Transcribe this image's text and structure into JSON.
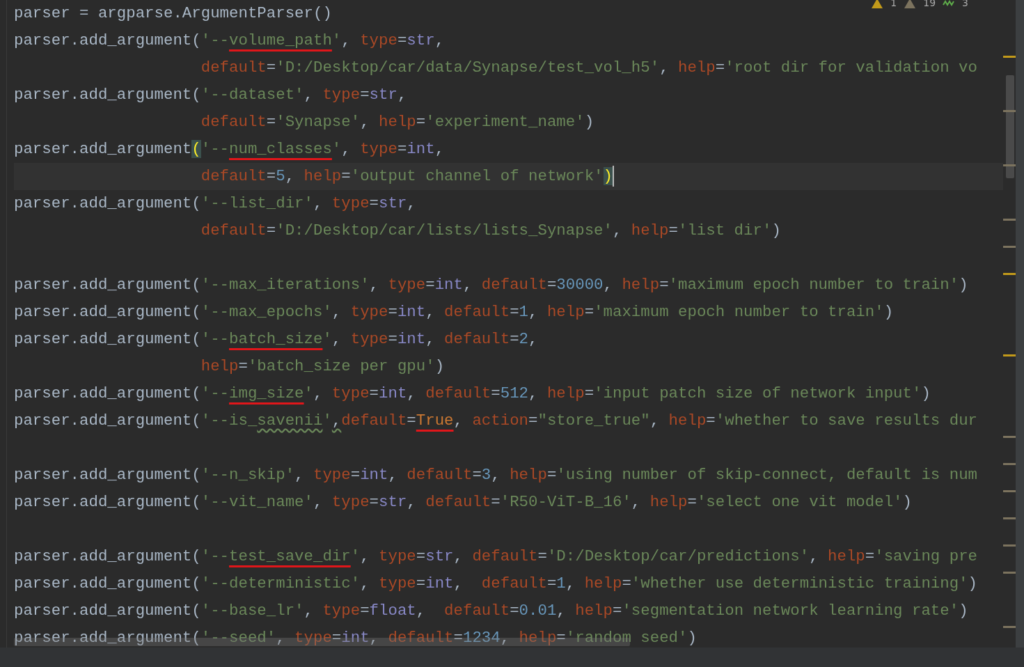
{
  "inspections": [
    {
      "kind": "warning",
      "count": "1"
    },
    {
      "kind": "weak",
      "count": "19"
    },
    {
      "kind": "typo",
      "count": "3"
    }
  ],
  "lines": [
    {
      "tokens": [
        {
          "kind": "plain",
          "text": "parser = argparse.ArgumentParser()"
        }
      ]
    },
    {
      "marker_warning": true,
      "tokens": [
        {
          "kind": "plain",
          "text": "parser.add_argument("
        },
        {
          "kind": "string",
          "text": "'--"
        },
        {
          "kind": "string",
          "text": "volume_path",
          "marked": true
        },
        {
          "kind": "string",
          "text": "'"
        },
        {
          "kind": "plain",
          "text": ", "
        },
        {
          "kind": "arg",
          "text": "type"
        },
        {
          "kind": "plain",
          "text": "="
        },
        {
          "kind": "builtin",
          "text": "str"
        },
        {
          "kind": "plain",
          "text": ","
        }
      ]
    },
    {
      "indent": true,
      "tokens": [
        {
          "kind": "arg",
          "text": "default"
        },
        {
          "kind": "plain",
          "text": "="
        },
        {
          "kind": "string",
          "text": "'D:/Desktop/car/data/Synapse/test_vol_h5'"
        },
        {
          "kind": "plain",
          "text": ", "
        },
        {
          "kind": "arg",
          "text": "help"
        },
        {
          "kind": "plain",
          "text": "="
        },
        {
          "kind": "string",
          "text": "'root dir for validation vo"
        }
      ]
    },
    {
      "marker_weak": true,
      "tokens": [
        {
          "kind": "plain",
          "text": "parser.add_argument("
        },
        {
          "kind": "string",
          "text": "'--dataset'"
        },
        {
          "kind": "plain",
          "text": ", "
        },
        {
          "kind": "arg",
          "text": "type"
        },
        {
          "kind": "plain",
          "text": "="
        },
        {
          "kind": "builtin",
          "text": "str"
        },
        {
          "kind": "plain",
          "text": ","
        }
      ]
    },
    {
      "indent": true,
      "tokens": [
        {
          "kind": "arg",
          "text": "default"
        },
        {
          "kind": "plain",
          "text": "="
        },
        {
          "kind": "string",
          "text": "'Synapse'"
        },
        {
          "kind": "plain",
          "text": ", "
        },
        {
          "kind": "arg",
          "text": "help"
        },
        {
          "kind": "plain",
          "text": "="
        },
        {
          "kind": "string",
          "text": "'experiment_name'"
        },
        {
          "kind": "plain",
          "text": ")"
        }
      ]
    },
    {
      "marker_weak": true,
      "tokens": [
        {
          "kind": "plain",
          "text": "parser.add_argument"
        },
        {
          "kind": "plain",
          "text": "(",
          "match": true
        },
        {
          "kind": "string",
          "text": "'--"
        },
        {
          "kind": "string",
          "text": "num_classes",
          "marked": true
        },
        {
          "kind": "string",
          "text": "'"
        },
        {
          "kind": "plain",
          "text": ", "
        },
        {
          "kind": "arg",
          "text": "type"
        },
        {
          "kind": "plain",
          "text": "="
        },
        {
          "kind": "builtin",
          "text": "int"
        },
        {
          "kind": "plain",
          "text": ","
        }
      ]
    },
    {
      "indent": true,
      "current": true,
      "tokens": [
        {
          "kind": "arg",
          "text": "default"
        },
        {
          "kind": "plain",
          "text": "="
        },
        {
          "kind": "number",
          "text": "5"
        },
        {
          "kind": "plain",
          "text": ", "
        },
        {
          "kind": "arg",
          "text": "help"
        },
        {
          "kind": "plain",
          "text": "="
        },
        {
          "kind": "string",
          "text": "'output channel of network'"
        },
        {
          "kind": "plain",
          "text": ")",
          "match": true
        }
      ]
    },
    {
      "marker_weak": true,
      "tokens": [
        {
          "kind": "plain",
          "text": "parser.add_argument("
        },
        {
          "kind": "string",
          "text": "'--list_dir'"
        },
        {
          "kind": "plain",
          "text": ", "
        },
        {
          "kind": "arg",
          "text": "type"
        },
        {
          "kind": "plain",
          "text": "="
        },
        {
          "kind": "builtin",
          "text": "str"
        },
        {
          "kind": "plain",
          "text": ","
        }
      ]
    },
    {
      "indent": true,
      "marker_weak": true,
      "tokens": [
        {
          "kind": "arg",
          "text": "default"
        },
        {
          "kind": "plain",
          "text": "="
        },
        {
          "kind": "string",
          "text": "'D:/Desktop/car/lists/lists_Synapse'"
        },
        {
          "kind": "plain",
          "text": ", "
        },
        {
          "kind": "arg",
          "text": "help"
        },
        {
          "kind": "plain",
          "text": "="
        },
        {
          "kind": "string",
          "text": "'list dir'"
        },
        {
          "kind": "plain",
          "text": ")"
        }
      ]
    },
    {
      "marker_warning": true
    },
    {
      "tokens": [
        {
          "kind": "plain",
          "text": "parser.add_argument("
        },
        {
          "kind": "string",
          "text": "'--max_iterations'"
        },
        {
          "kind": "plain",
          "text": ", "
        },
        {
          "kind": "arg",
          "text": "type"
        },
        {
          "kind": "plain",
          "text": "="
        },
        {
          "kind": "builtin",
          "text": "int"
        },
        {
          "kind": "plain",
          "text": ", "
        },
        {
          "kind": "arg",
          "text": "default"
        },
        {
          "kind": "plain",
          "text": "="
        },
        {
          "kind": "number",
          "text": "30000"
        },
        {
          "kind": "plain",
          "text": ", "
        },
        {
          "kind": "arg",
          "text": "help"
        },
        {
          "kind": "plain",
          "text": "="
        },
        {
          "kind": "string",
          "text": "'maximum epoch number to train'"
        },
        {
          "kind": "plain",
          "text": ")"
        }
      ]
    },
    {
      "tokens": [
        {
          "kind": "plain",
          "text": "parser.add_argument("
        },
        {
          "kind": "string",
          "text": "'--max_epochs'"
        },
        {
          "kind": "plain",
          "text": ", "
        },
        {
          "kind": "arg",
          "text": "type"
        },
        {
          "kind": "plain",
          "text": "="
        },
        {
          "kind": "builtin",
          "text": "int"
        },
        {
          "kind": "plain",
          "text": ", "
        },
        {
          "kind": "arg",
          "text": "default"
        },
        {
          "kind": "plain",
          "text": "="
        },
        {
          "kind": "number",
          "text": "1"
        },
        {
          "kind": "plain",
          "text": ", "
        },
        {
          "kind": "arg",
          "text": "help"
        },
        {
          "kind": "plain",
          "text": "="
        },
        {
          "kind": "string",
          "text": "'maximum epoch number to train'"
        },
        {
          "kind": "plain",
          "text": ")"
        }
      ]
    },
    {
      "marker_warning": true,
      "tokens": [
        {
          "kind": "plain",
          "text": "parser.add_argument("
        },
        {
          "kind": "string",
          "text": "'--"
        },
        {
          "kind": "string",
          "text": "batch_size",
          "marked": true
        },
        {
          "kind": "string",
          "text": "'"
        },
        {
          "kind": "plain",
          "text": ", "
        },
        {
          "kind": "arg",
          "text": "type"
        },
        {
          "kind": "plain",
          "text": "="
        },
        {
          "kind": "builtin",
          "text": "int"
        },
        {
          "kind": "plain",
          "text": ", "
        },
        {
          "kind": "arg",
          "text": "default"
        },
        {
          "kind": "plain",
          "text": "="
        },
        {
          "kind": "number",
          "text": "2"
        },
        {
          "kind": "plain",
          "text": ","
        }
      ]
    },
    {
      "indent": true,
      "tokens": [
        {
          "kind": "arg",
          "text": "help"
        },
        {
          "kind": "plain",
          "text": "="
        },
        {
          "kind": "string",
          "text": "'batch_size per gpu'"
        },
        {
          "kind": "plain",
          "text": ")"
        }
      ]
    },
    {
      "tokens": [
        {
          "kind": "plain",
          "text": "parser.add_argument("
        },
        {
          "kind": "string",
          "text": "'--"
        },
        {
          "kind": "string",
          "text": "img_size",
          "marked": true
        },
        {
          "kind": "string",
          "text": "'"
        },
        {
          "kind": "plain",
          "text": ", "
        },
        {
          "kind": "arg",
          "text": "type"
        },
        {
          "kind": "plain",
          "text": "="
        },
        {
          "kind": "builtin",
          "text": "int"
        },
        {
          "kind": "plain",
          "text": ", "
        },
        {
          "kind": "arg",
          "text": "default"
        },
        {
          "kind": "plain",
          "text": "="
        },
        {
          "kind": "number",
          "text": "512"
        },
        {
          "kind": "plain",
          "text": ", "
        },
        {
          "kind": "arg",
          "text": "help"
        },
        {
          "kind": "plain",
          "text": "="
        },
        {
          "kind": "string",
          "text": "'input patch size of network input'"
        },
        {
          "kind": "plain",
          "text": ")"
        }
      ]
    },
    {
      "marker_weak": true,
      "tokens": [
        {
          "kind": "plain",
          "text": "parser.add_argument("
        },
        {
          "kind": "string",
          "text": "'--is_"
        },
        {
          "kind": "string",
          "text": "savenii",
          "typo": true
        },
        {
          "kind": "string",
          "text": "'"
        },
        {
          "kind": "plain",
          "text": ",",
          "typo": true
        },
        {
          "kind": "arg",
          "text": "default"
        },
        {
          "kind": "plain",
          "text": "="
        },
        {
          "kind": "keyword",
          "text": "True",
          "marked": true
        },
        {
          "kind": "plain",
          "text": ", "
        },
        {
          "kind": "arg",
          "text": "action"
        },
        {
          "kind": "plain",
          "text": "="
        },
        {
          "kind": "string",
          "text": "\"store_true\""
        },
        {
          "kind": "plain",
          "text": ", "
        },
        {
          "kind": "arg",
          "text": "help"
        },
        {
          "kind": "plain",
          "text": "="
        },
        {
          "kind": "string",
          "text": "'whether to save results dur"
        }
      ]
    },
    {
      "marker_weak": true
    },
    {
      "marker_weak": true,
      "tokens": [
        {
          "kind": "plain",
          "text": "parser.add_argument("
        },
        {
          "kind": "string",
          "text": "'--n_skip'"
        },
        {
          "kind": "plain",
          "text": ", "
        },
        {
          "kind": "arg",
          "text": "type"
        },
        {
          "kind": "plain",
          "text": "="
        },
        {
          "kind": "builtin",
          "text": "int"
        },
        {
          "kind": "plain",
          "text": ", "
        },
        {
          "kind": "arg",
          "text": "default"
        },
        {
          "kind": "plain",
          "text": "="
        },
        {
          "kind": "number",
          "text": "3"
        },
        {
          "kind": "plain",
          "text": ", "
        },
        {
          "kind": "arg",
          "text": "help"
        },
        {
          "kind": "plain",
          "text": "="
        },
        {
          "kind": "string",
          "text": "'using number of skip-connect, default is num"
        }
      ]
    },
    {
      "marker_weak": true,
      "tokens": [
        {
          "kind": "plain",
          "text": "parser.add_argument("
        },
        {
          "kind": "string",
          "text": "'--vit_name'"
        },
        {
          "kind": "plain",
          "text": ", "
        },
        {
          "kind": "arg",
          "text": "type"
        },
        {
          "kind": "plain",
          "text": "="
        },
        {
          "kind": "builtin",
          "text": "str"
        },
        {
          "kind": "plain",
          "text": ", "
        },
        {
          "kind": "arg",
          "text": "default"
        },
        {
          "kind": "plain",
          "text": "="
        },
        {
          "kind": "string",
          "text": "'R50-ViT-B_16'"
        },
        {
          "kind": "plain",
          "text": ", "
        },
        {
          "kind": "arg",
          "text": "help"
        },
        {
          "kind": "plain",
          "text": "="
        },
        {
          "kind": "string",
          "text": "'select one vit model'"
        },
        {
          "kind": "plain",
          "text": ")"
        }
      ]
    },
    {
      "marker_weak": true
    },
    {
      "marker_weak": true,
      "tokens": [
        {
          "kind": "plain",
          "text": "parser.add_argument("
        },
        {
          "kind": "string",
          "text": "'--"
        },
        {
          "kind": "string",
          "text": "test_save_dir",
          "marked": true
        },
        {
          "kind": "string",
          "text": "'"
        },
        {
          "kind": "plain",
          "text": ", "
        },
        {
          "kind": "arg",
          "text": "type"
        },
        {
          "kind": "plain",
          "text": "="
        },
        {
          "kind": "builtin",
          "text": "str"
        },
        {
          "kind": "plain",
          "text": ", "
        },
        {
          "kind": "arg",
          "text": "default"
        },
        {
          "kind": "plain",
          "text": "="
        },
        {
          "kind": "string",
          "text": "'D:/Desktop/car/predictions'"
        },
        {
          "kind": "plain",
          "text": ", "
        },
        {
          "kind": "arg",
          "text": "help"
        },
        {
          "kind": "plain",
          "text": "="
        },
        {
          "kind": "string",
          "text": "'saving pre"
        }
      ]
    },
    {
      "tokens": [
        {
          "kind": "plain",
          "text": "parser.add_argument("
        },
        {
          "kind": "string",
          "text": "'--deterministic'"
        },
        {
          "kind": "plain",
          "text": ", "
        },
        {
          "kind": "arg",
          "text": "type"
        },
        {
          "kind": "plain",
          "text": "="
        },
        {
          "kind": "builtin",
          "text": "int"
        },
        {
          "kind": "plain",
          "text": ",  "
        },
        {
          "kind": "arg",
          "text": "default"
        },
        {
          "kind": "plain",
          "text": "="
        },
        {
          "kind": "number",
          "text": "1"
        },
        {
          "kind": "plain",
          "text": ", "
        },
        {
          "kind": "arg",
          "text": "help"
        },
        {
          "kind": "plain",
          "text": "="
        },
        {
          "kind": "string",
          "text": "'whether use deterministic training'"
        },
        {
          "kind": "plain",
          "text": ")"
        }
      ]
    },
    {
      "marker_weak": true,
      "tokens": [
        {
          "kind": "plain",
          "text": "parser.add_argument("
        },
        {
          "kind": "string",
          "text": "'--base_lr'"
        },
        {
          "kind": "plain",
          "text": ", "
        },
        {
          "kind": "arg",
          "text": "type"
        },
        {
          "kind": "plain",
          "text": "="
        },
        {
          "kind": "builtin",
          "text": "float"
        },
        {
          "kind": "plain",
          "text": ",  "
        },
        {
          "kind": "arg",
          "text": "default"
        },
        {
          "kind": "plain",
          "text": "="
        },
        {
          "kind": "number",
          "text": "0.01"
        },
        {
          "kind": "plain",
          "text": ", "
        },
        {
          "kind": "arg",
          "text": "help"
        },
        {
          "kind": "plain",
          "text": "="
        },
        {
          "kind": "string",
          "text": "'segmentation network learning rate'"
        },
        {
          "kind": "plain",
          "text": ")"
        }
      ]
    },
    {
      "tokens": [
        {
          "kind": "plain",
          "text": "parser.add_argument("
        },
        {
          "kind": "string",
          "text": "'--seed'"
        },
        {
          "kind": "plain",
          "text": ", "
        },
        {
          "kind": "arg",
          "text": "type"
        },
        {
          "kind": "plain",
          "text": "="
        },
        {
          "kind": "builtin",
          "text": "int"
        },
        {
          "kind": "plain",
          "text": ", "
        },
        {
          "kind": "arg",
          "text": "default"
        },
        {
          "kind": "plain",
          "text": "="
        },
        {
          "kind": "number",
          "text": "1234"
        },
        {
          "kind": "plain",
          "text": ", "
        },
        {
          "kind": "arg",
          "text": "help"
        },
        {
          "kind": "plain",
          "text": "="
        },
        {
          "kind": "string",
          "text": "'random seed'"
        },
        {
          "kind": "plain",
          "text": ")"
        }
      ]
    }
  ]
}
